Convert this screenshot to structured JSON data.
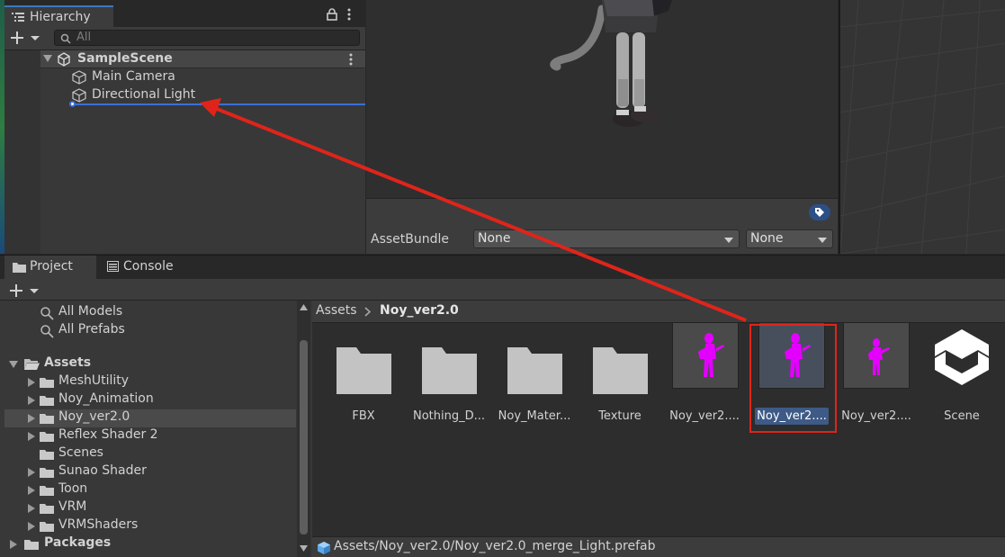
{
  "hierarchy": {
    "tab_label": "Hierarchy",
    "search_placeholder": "All",
    "scene_name": "SampleScene",
    "items": [
      "Main Camera",
      "Directional Light"
    ]
  },
  "inspector": {
    "asset_bundle_label": "AssetBundle",
    "asset_bundle_value": "None",
    "variant_value": "None"
  },
  "project": {
    "tabs": [
      "Project",
      "Console"
    ],
    "favorites": [
      "All Models",
      "All Prefabs"
    ],
    "tree": {
      "root": "Assets",
      "children": [
        "MeshUtility",
        "Noy_Animation",
        "Noy_ver2.0",
        "Reflex Shader 2",
        "Scenes",
        "Sunao Shader",
        "Toon",
        "VRM",
        "VRMShaders"
      ],
      "packages": "Packages"
    },
    "breadcrumb": {
      "root": "Assets",
      "current": "Noy_ver2.0"
    },
    "assets": [
      "FBX",
      "Nothing_D...",
      "Noy_Mater...",
      "Texture",
      "Noy_ver2....",
      "Noy_ver2....",
      "Noy_ver2....",
      "Scene"
    ],
    "status_path": "Assets/Noy_ver2.0/Noy_ver2.0_merge_Light.prefab"
  },
  "colors": {
    "accent_red": "#e0241a",
    "selection_blue": "#3a6fd8",
    "prefab_magenta": "#e400ff"
  }
}
